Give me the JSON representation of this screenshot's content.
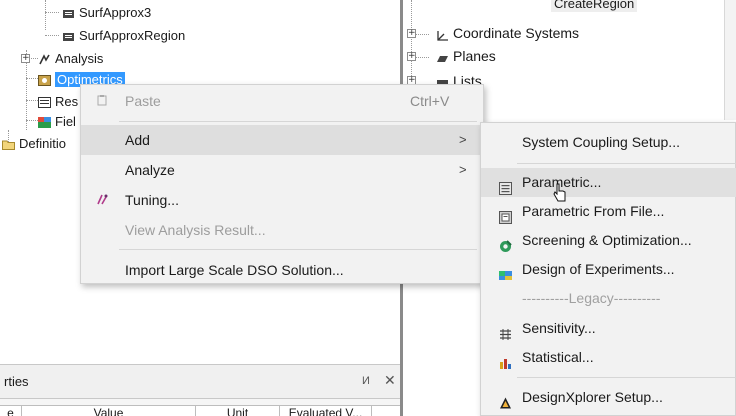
{
  "project_tree": {
    "items": [
      {
        "label": "SurfApprox3"
      },
      {
        "label": "SurfApproxRegion"
      },
      {
        "label": "Analysis",
        "expander": "+"
      },
      {
        "label": "Optimetrics"
      },
      {
        "label": "Res"
      },
      {
        "label": "Fiel"
      },
      {
        "label": "Definitio"
      }
    ]
  },
  "right_tree": {
    "items": [
      {
        "label": "CreateRegion",
        "expander": ""
      },
      {
        "label": "Coordinate Systems",
        "expander": "+"
      },
      {
        "label": "Planes",
        "expander": "+"
      },
      {
        "label": "Lists",
        "expander": "+"
      }
    ]
  },
  "properties_panel": {
    "title": "rties",
    "pin_glyph": "И",
    "close_glyph": "✕",
    "columns": [
      "e",
      "Value",
      "Unit",
      "Evaluated V..."
    ]
  },
  "context_menu": {
    "items": [
      {
        "label": "Paste",
        "shortcut": "Ctrl+V",
        "disabled": true,
        "icon": "paste-icon"
      },
      {
        "label": "Add",
        "submenu": true,
        "highlighted": true
      },
      {
        "label": "Analyze",
        "submenu": true
      },
      {
        "label": "Tuning...",
        "icon": "tuning-icon"
      },
      {
        "label": "View Analysis Result...",
        "disabled": true
      },
      {
        "label": "Import Large Scale DSO Solution..."
      }
    ],
    "arrow_glyph": ">"
  },
  "add_submenu": {
    "items": [
      {
        "label": "System Coupling Setup..."
      },
      {
        "label": "Parametric...",
        "icon": "parametric-icon",
        "highlighted": true
      },
      {
        "label": "Parametric From File...",
        "icon": "parametric-file-icon"
      },
      {
        "label": "Screening & Optimization...",
        "icon": "optimization-icon"
      },
      {
        "label": "Design of Experiments...",
        "icon": "doe-icon"
      },
      {
        "label": "----------Legacy----------",
        "disabled": true
      },
      {
        "label": "Sensitivity...",
        "icon": "sensitivity-icon"
      },
      {
        "label": "Statistical...",
        "icon": "statistical-icon"
      },
      {
        "label": "DesignXplorer Setup...",
        "icon": "designxplorer-icon"
      }
    ]
  },
  "colors": {
    "selection": "#3399ff",
    "menu_bg": "#f2f2f2",
    "menu_hover": "#dedede",
    "disabled_text": "#9d9d9d"
  }
}
